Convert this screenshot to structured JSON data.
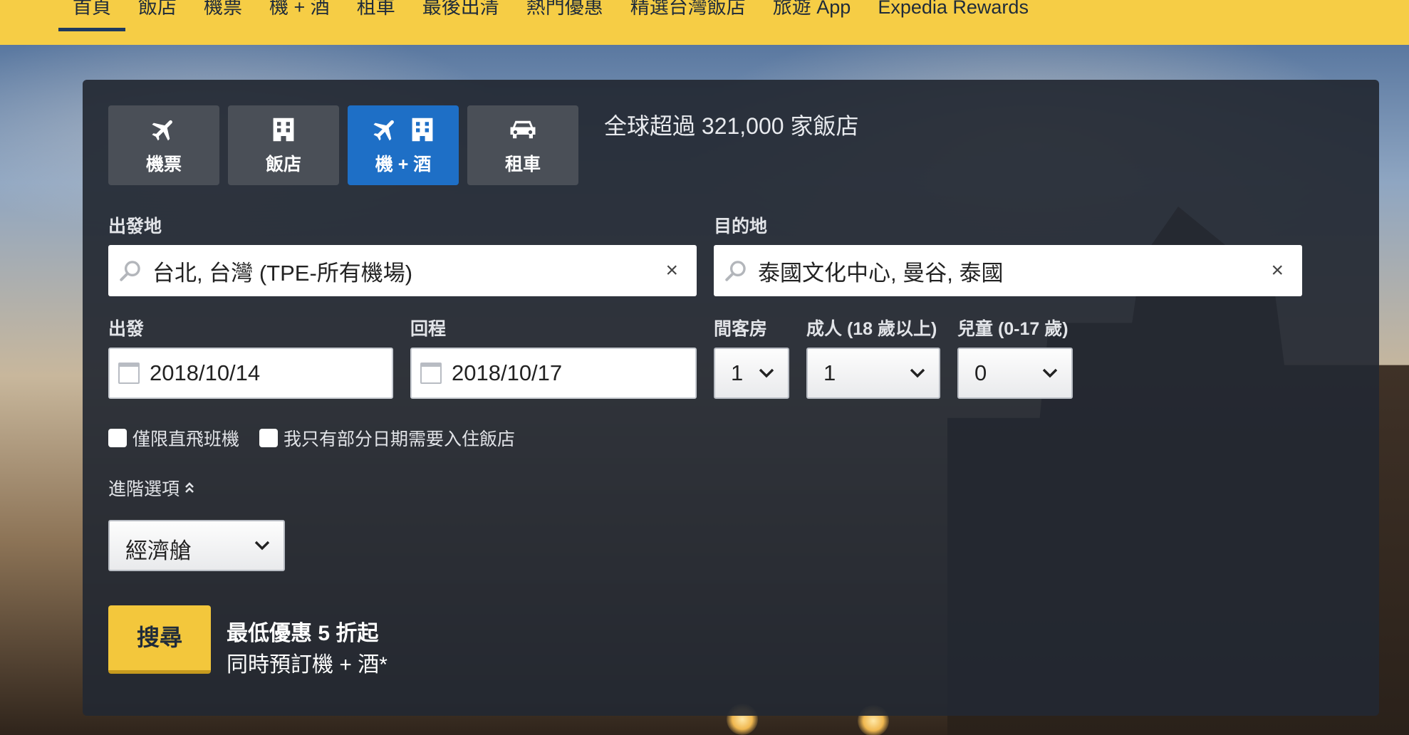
{
  "nav": {
    "items": [
      "首頁",
      "飯店",
      "機票",
      "機 + 酒",
      "租車",
      "最後出清",
      "熱門優惠",
      "精選台灣飯店",
      "旅遊 App",
      "Expedia Rewards"
    ],
    "active": "首頁"
  },
  "tabs": [
    {
      "label": "機票",
      "icons": [
        "plane-icon"
      ]
    },
    {
      "label": "飯店",
      "icons": [
        "hotel-icon"
      ]
    },
    {
      "label": "機 + 酒",
      "icons": [
        "plane-icon",
        "hotel-icon"
      ],
      "active": true
    },
    {
      "label": "租車",
      "icons": [
        "car-icon"
      ]
    }
  ],
  "panel_title": "全球超過 321,000 家飯店",
  "origin": {
    "label": "出發地",
    "value": "台北, 台灣 (TPE-所有機場)",
    "clear": "×"
  },
  "destination": {
    "label": "目的地",
    "value": "泰國文化中心, 曼谷, 泰國",
    "clear": "×"
  },
  "depart": {
    "label": "出發",
    "value": "2018/10/14"
  },
  "return": {
    "label": "回程",
    "value": "2018/10/17"
  },
  "rooms": {
    "label": "間客房",
    "value": "1"
  },
  "adults": {
    "label": "成人 (18 歲以上)",
    "value": "1"
  },
  "children": {
    "label": "兒童 (0-17 歲)",
    "value": "0"
  },
  "checkboxes": {
    "direct_only": "僅限直飛班機",
    "partial_hotel": "我只有部分日期需要入住飯店"
  },
  "advanced": {
    "label": "進階選項"
  },
  "cabin": {
    "value": "經濟艙"
  },
  "search_button": "搜尋",
  "promo": {
    "line1": "最低優惠 5 折起",
    "line2": "同時預訂機 + 酒*"
  },
  "colors": {
    "nav_bg": "#f6cd45",
    "active_tab": "#1e6fc6",
    "search_button": "#f3c73c",
    "panel_bg": "#23283233"
  }
}
